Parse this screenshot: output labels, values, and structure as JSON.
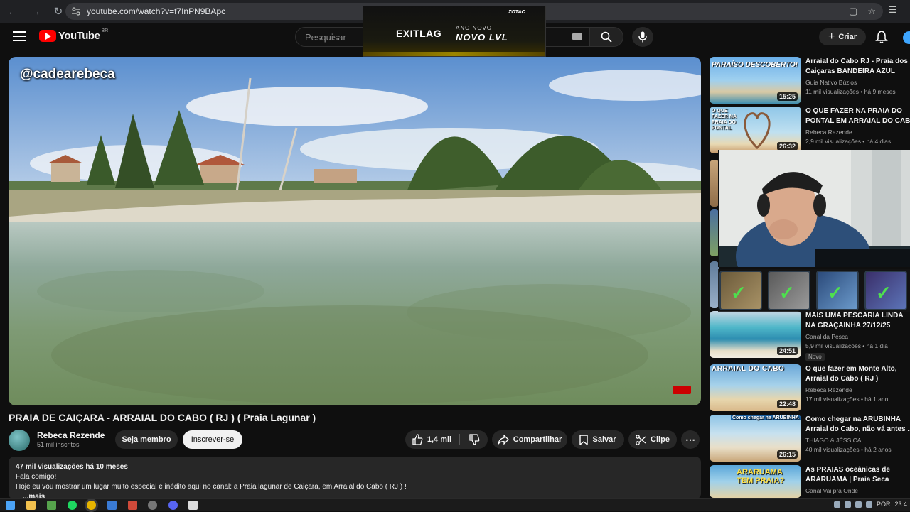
{
  "browser": {
    "url": "youtube.com/watch?v=f7InPN9BApc",
    "icons": [
      "back-icon",
      "forward-icon",
      "reload-icon",
      "site-settings-icon",
      "install-icon",
      "bookmark-star-icon",
      "extensions-icon"
    ]
  },
  "header": {
    "logo": "YouTube",
    "logo_country": "BR",
    "search_placeholder": "Pesquisar",
    "create_label": "Criar"
  },
  "ad": {
    "brand": "EXITLAG",
    "line1": "ANO NOVO",
    "line2": "NOVO LVL"
  },
  "video": {
    "handle": "@cadearebeca",
    "title": "PRAIA DE CAIÇARA - ARRAIAL DO CABO ( RJ ) ( Praia Lagunar )",
    "channel": "Rebeca Rezende",
    "subscribers": "51 mil inscritos",
    "member_label": "Seja membro",
    "subscribe_label": "Inscrever-se",
    "likes": "1,4 mil",
    "share_label": "Compartilhar",
    "save_label": "Salvar",
    "clip_label": "Clipe"
  },
  "description": {
    "meta": "47 mil visualizações  há 10 meses",
    "line1": "Fala comigo!",
    "line2": "Hoje eu vou mostrar um lugar muito especial e inédito aqui no canal: a Praia lagunar de Caiçara, em Arraial do Cabo ( RJ ) !",
    "more": "...mais"
  },
  "sidebar": [
    {
      "title1": "Arraial do Cabo RJ - Praia dos",
      "title2": "Caiçaras BANDEIRA AZUL",
      "channel": "Guia Nativo Búzios",
      "meta": "11 mil visualizações • há 9 meses",
      "duration": "15:25",
      "overlay": "PARAÍSO DESCOBERTO!",
      "badge": ""
    },
    {
      "title1": "O QUE FAZER NA PRAIA DO",
      "title2": "PONTAL EM ARRAIAL DO CABO",
      "channel": "Rebeca Rezende",
      "meta": "2,9 mil visualizações • há 4 dias",
      "duration": "26:32",
      "overlay": "O QUE FAZER NA PRAIA DO PONTAL",
      "badge": ""
    },
    {
      "title1": "MAIS UMA PESCARIA LINDA",
      "title2": "NA GRAÇAINHA 27/12/25",
      "channel": "Canal da Pesca",
      "meta": "5,9 mil visualizações • há 1 dia",
      "duration": "24:51",
      "overlay": "",
      "badge": "Novo"
    },
    {
      "title1": "O que fazer em Monte Alto,",
      "title2": "Arraial do Cabo ( RJ )",
      "channel": "Rebeca Rezende",
      "meta": "17 mil visualizações • há 1 ano",
      "duration": "22:48",
      "overlay": "ARRAIAL DO CABO",
      "badge": ""
    },
    {
      "title1": "Como chegar na ARUBINHA",
      "title2": "Arraial do Cabo, não vá antes ...",
      "channel": "THIAGO & JÉSSICA",
      "meta": "40 mil visualizações • há 2 anos",
      "duration": "26:15",
      "overlay": "Como chegar na ARUBINHA",
      "badge": ""
    },
    {
      "title1": "As PRAIAS oceânicas de",
      "title2": "ARARUAMA | Praia Seca",
      "channel": "Canal Vai pra Onde",
      "meta": "",
      "duration": "",
      "overlay": "ARARUAMA TEM PRAIA?",
      "badge": ""
    }
  ],
  "taskbar": {
    "lang": "POR",
    "time": "23:4"
  }
}
